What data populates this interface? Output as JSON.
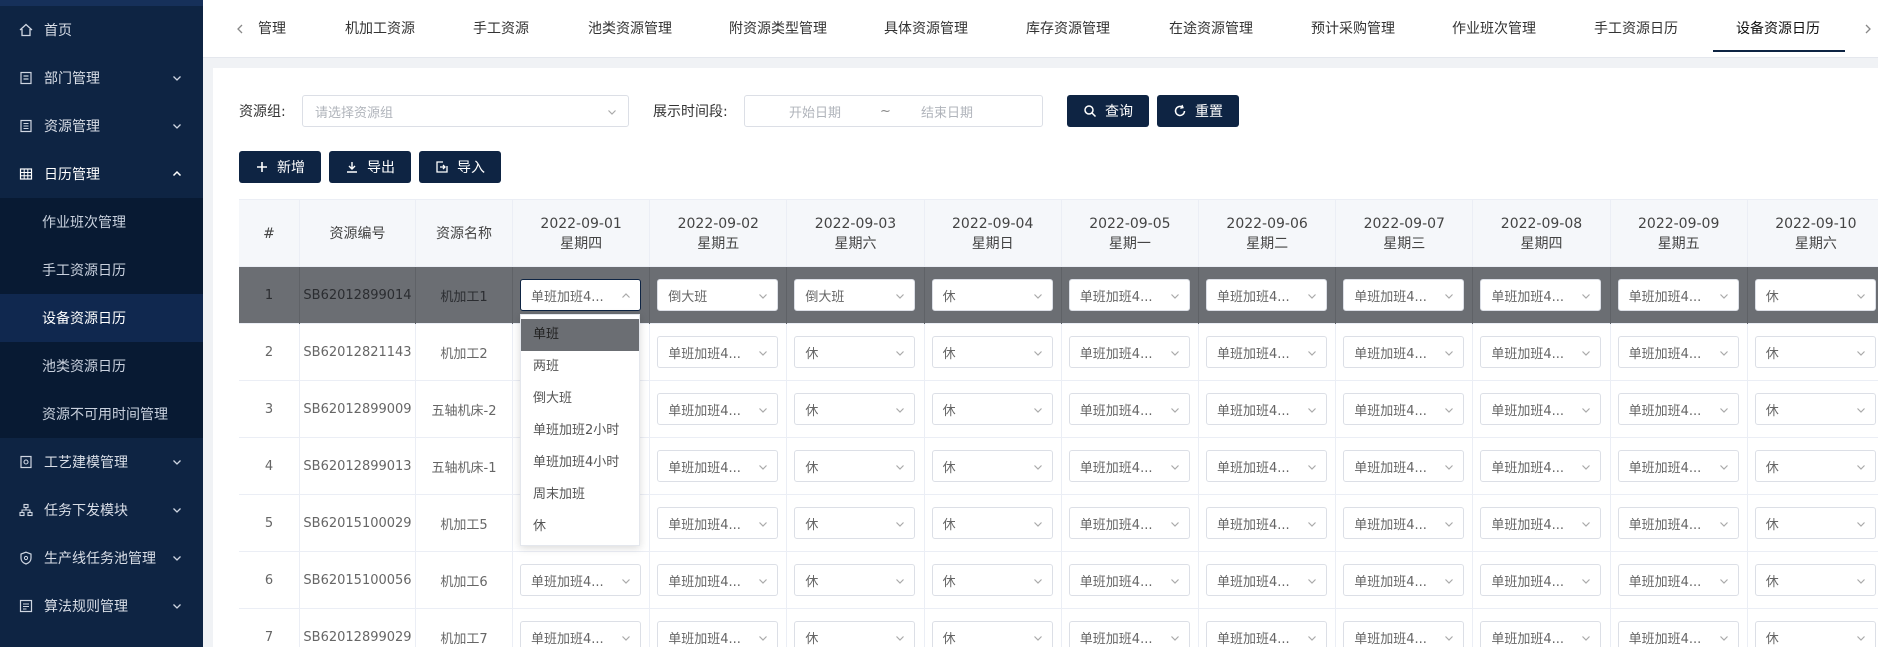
{
  "sidebar": {
    "items": [
      {
        "label": "首页",
        "icon": "home-icon"
      },
      {
        "label": "部门管理",
        "icon": "department-icon"
      },
      {
        "label": "资源管理",
        "icon": "resource-icon"
      },
      {
        "label": "日历管理",
        "icon": "calendar-grid-icon"
      },
      {
        "label": "工艺建模管理",
        "icon": "process-icon"
      },
      {
        "label": "任务下发模块",
        "icon": "task-tree-icon"
      },
      {
        "label": "生产线任务池管理",
        "icon": "shield-icon"
      },
      {
        "label": "算法规则管理",
        "icon": "rules-icon"
      }
    ],
    "submenu": [
      "作业班次管理",
      "手工资源日历",
      "设备资源日历",
      "池类资源日历",
      "资源不可用时间管理"
    ]
  },
  "tabs": {
    "items": [
      "管理",
      "机加工资源",
      "手工资源",
      "池类资源管理",
      "附资源类型管理",
      "具体资源管理",
      "库存资源管理",
      "在途资源管理",
      "预计采购管理",
      "作业班次管理",
      "手工资源日历",
      "设备资源日历"
    ],
    "active": "设备资源日历"
  },
  "filters": {
    "group_label": "资源组:",
    "group_placeholder": "请选择资源组",
    "time_label": "展示时间段:",
    "start_placeholder": "开始日期",
    "range_sep": "~",
    "end_placeholder": "结束日期"
  },
  "buttons": {
    "search": "查询",
    "reset": "重置",
    "add": "新增",
    "export": "导出",
    "import": "导入"
  },
  "table": {
    "fixed_headers": [
      "#",
      "资源编号",
      "资源名称"
    ],
    "dates": [
      {
        "date": "2022-09-01",
        "weekday": "星期四"
      },
      {
        "date": "2022-09-02",
        "weekday": "星期五"
      },
      {
        "date": "2022-09-03",
        "weekday": "星期六"
      },
      {
        "date": "2022-09-04",
        "weekday": "星期日"
      },
      {
        "date": "2022-09-05",
        "weekday": "星期一"
      },
      {
        "date": "2022-09-06",
        "weekday": "星期二"
      },
      {
        "date": "2022-09-07",
        "weekday": "星期三"
      },
      {
        "date": "2022-09-08",
        "weekday": "星期四"
      },
      {
        "date": "2022-09-09",
        "weekday": "星期五"
      },
      {
        "date": "2022-09-10",
        "weekday": "星期六"
      }
    ],
    "rows": [
      {
        "index": "1",
        "code": "SB62012899014",
        "name": "机加工1",
        "cells": [
          "单班加班4...",
          "倒大班",
          "倒大班",
          "休",
          "单班加班4...",
          "单班加班4...",
          "单班加班4...",
          "单班加班4...",
          "单班加班4...",
          "休"
        ]
      },
      {
        "index": "2",
        "code": "SB62012821143",
        "name": "机加工2",
        "cells": [
          "",
          "单班加班4...",
          "休",
          "休",
          "单班加班4...",
          "单班加班4...",
          "单班加班4...",
          "单班加班4...",
          "单班加班4...",
          "休"
        ]
      },
      {
        "index": "3",
        "code": "SB62012899009",
        "name": "五轴机床-2",
        "cells": [
          "",
          "单班加班4...",
          "休",
          "休",
          "单班加班4...",
          "单班加班4...",
          "单班加班4...",
          "单班加班4...",
          "单班加班4...",
          "休"
        ]
      },
      {
        "index": "4",
        "code": "SB62012899013",
        "name": "五轴机床-1",
        "cells": [
          "",
          "单班加班4...",
          "休",
          "休",
          "单班加班4...",
          "单班加班4...",
          "单班加班4...",
          "单班加班4...",
          "单班加班4...",
          "休"
        ]
      },
      {
        "index": "5",
        "code": "SB62015100029",
        "name": "机加工5",
        "cells": [
          "",
          "单班加班4...",
          "休",
          "休",
          "单班加班4...",
          "单班加班4...",
          "单班加班4...",
          "单班加班4...",
          "单班加班4...",
          "休"
        ]
      },
      {
        "index": "6",
        "code": "SB62015100056",
        "name": "机加工6",
        "cells": [
          "单班加班4...",
          "单班加班4...",
          "休",
          "休",
          "单班加班4...",
          "单班加班4...",
          "单班加班4...",
          "单班加班4...",
          "单班加班4...",
          "休"
        ]
      },
      {
        "index": "7",
        "code": "SB62012899029",
        "name": "机加工7",
        "cells": [
          "单班加班4...",
          "单班加班4...",
          "休",
          "休",
          "单班加班4...",
          "单班加班4...",
          "单班加班4...",
          "单班加班4...",
          "单班加班4...",
          "休"
        ]
      }
    ]
  },
  "dropdown": {
    "options": [
      "单班",
      "两班",
      "倒大班",
      "单班加班2小时",
      "单班加班4小时",
      "周末加班",
      "休"
    ],
    "highlighted": "单班"
  }
}
